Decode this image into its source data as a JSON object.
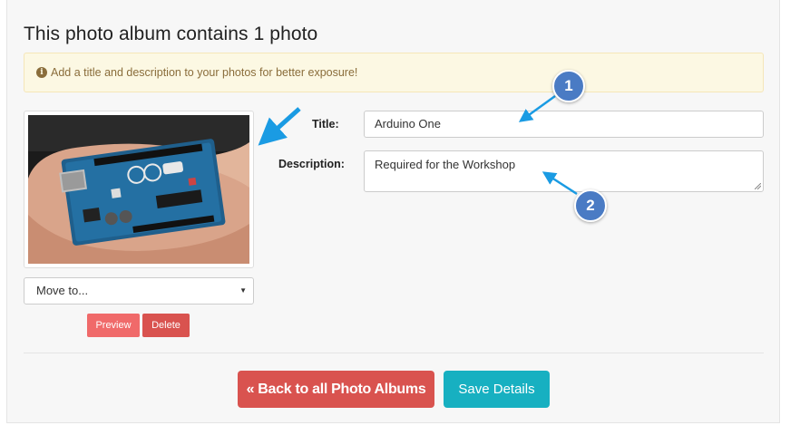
{
  "heading": "This photo album contains 1 photo",
  "alert": {
    "icon": "info-icon",
    "text": "Add a title and description to your photos for better exposure!"
  },
  "photo": {
    "icon": "arduino-board-photo"
  },
  "move_select": {
    "value": "Move to..."
  },
  "photo_actions": {
    "preview": "Preview",
    "delete": "Delete"
  },
  "form": {
    "title_label": "Title:",
    "title_value": "Arduino One",
    "description_label": "Description:",
    "description_value": "Required for the Workshop"
  },
  "footer": {
    "back_label": "« Back to all Photo Albums",
    "save_label": "Save Details"
  },
  "annotations": {
    "badge_1": "1",
    "badge_2": "2",
    "arrow_color": "#1a9be3",
    "badge_color": "#4a7bc4"
  },
  "colors": {
    "danger": "#d9534f",
    "danger_light": "#f06a6a",
    "info": "#17b0c1",
    "alert_bg": "#fcf8e3",
    "alert_text": "#8a6d3b"
  }
}
